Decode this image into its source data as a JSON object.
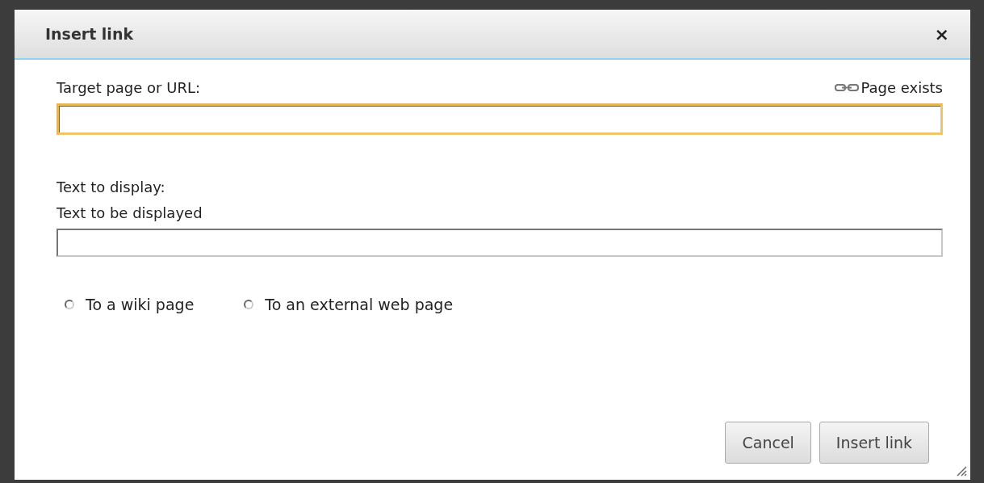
{
  "dialog": {
    "title": "Insert link",
    "close": "×"
  },
  "target": {
    "label": "Target page or URL:",
    "status": "Page exists",
    "focused": true
  },
  "display": {
    "label": "Text to display:",
    "hint": "Text to be displayed"
  },
  "link_types": [
    {
      "label": "To a wiki page",
      "selected": false
    },
    {
      "label": "To an external web page",
      "selected": false
    }
  ],
  "buttons": [
    {
      "label": "Cancel"
    },
    {
      "label": "Insert link"
    }
  ]
}
